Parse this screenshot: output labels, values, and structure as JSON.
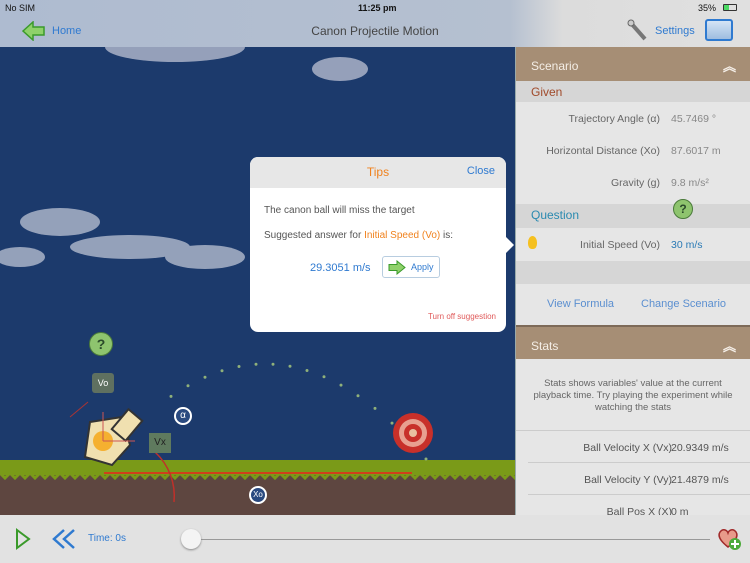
{
  "status": {
    "carrier": "No SIM",
    "time": "11:25 pm",
    "battery": "35%"
  },
  "nav": {
    "home": "Home",
    "title": "Canon Projectile Motion",
    "settings": "Settings"
  },
  "scene": {
    "labels": {
      "vo": "Vo",
      "vx": "Vx",
      "alpha": "α",
      "xo": "Xo",
      "question": "?"
    }
  },
  "tips": {
    "title": "Tips",
    "close": "Close",
    "message": "The canon ball will miss the target",
    "suggest_prefix": "Suggested answer for ",
    "suggest_var": "Initial Speed (Vo)",
    "suggest_suffix": " is:",
    "answer": "29.3051 m/s",
    "apply": "Apply",
    "turn_off": "Turn off suggestion"
  },
  "scenario": {
    "header": "Scenario",
    "given_label": "Given",
    "given": [
      {
        "label": "Trajectory Angle (α)",
        "value": "45.7469 °"
      },
      {
        "label": "Horizontal Distance (Xo)",
        "value": "87.6017 m"
      },
      {
        "label": "Gravity (g)",
        "value": "9.8 m/s²"
      }
    ],
    "question_label": "Question",
    "question": {
      "label": "Initial Speed (Vo)",
      "value": "30 m/s"
    },
    "view_formula": "View Formula",
    "change_scenario": "Change Scenario"
  },
  "stats": {
    "header": "Stats",
    "description": "Stats shows variables' value at the current playback time. Try playing the experiment while watching the stats",
    "rows": [
      {
        "label": "Ball Velocity X (Vx)",
        "value": "20.9349 m/s"
      },
      {
        "label": "Ball Velocity Y (Vy)",
        "value": "21.4879 m/s"
      },
      {
        "label": "Ball Pos X (X)",
        "value": "0 m"
      }
    ]
  },
  "playback": {
    "time": "Time: 0s",
    "progress": 0
  },
  "colors": {
    "accent": "#2f7ad0",
    "brown": "#a68e75",
    "orange": "#f0821e",
    "sky": "#1c3a6c"
  }
}
